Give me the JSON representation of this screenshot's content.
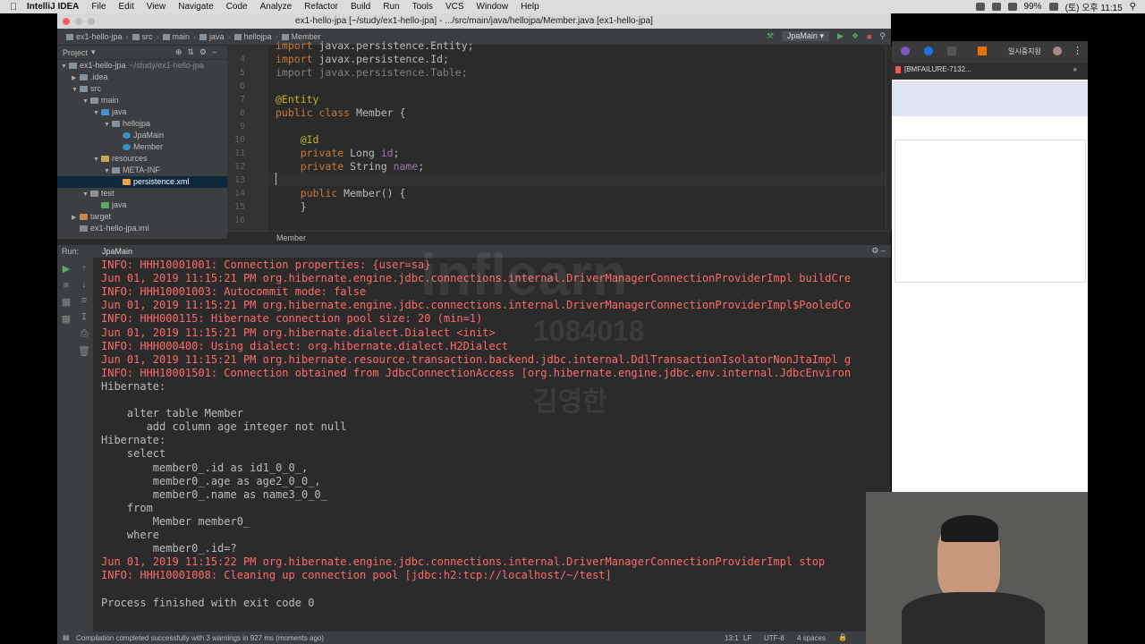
{
  "menubar": {
    "app_name": "IntelliJ IDEA",
    "items": [
      "File",
      "Edit",
      "View",
      "Navigate",
      "Code",
      "Analyze",
      "Refactor",
      "Build",
      "Run",
      "Tools",
      "VCS",
      "Window",
      "Help"
    ],
    "battery": "99%",
    "clock": "(토) 오후 11:15"
  },
  "window": {
    "title": "ex1-hello-jpa [~/study/ex1-hello-jpa] - .../src/main/java/hellojpa/Member.java [ex1-hello-jpa]"
  },
  "navbar": {
    "crumbs": [
      "ex1-hello-jpa",
      "src",
      "main",
      "java",
      "hellojpa",
      "Member"
    ],
    "run_config": "JpaMain"
  },
  "project": {
    "header": "Project",
    "tree": [
      {
        "label": "ex1-hello-jpa",
        "extra": "~/study/ex1-hello-jpa",
        "depth": 0,
        "arrow": "▼",
        "kind": "module"
      },
      {
        "label": ".idea",
        "depth": 1,
        "arrow": "▶",
        "kind": "folder"
      },
      {
        "label": "src",
        "depth": 1,
        "arrow": "▼",
        "kind": "folder"
      },
      {
        "label": "main",
        "depth": 2,
        "arrow": "▼",
        "kind": "folder"
      },
      {
        "label": "java",
        "depth": 3,
        "arrow": "▼",
        "kind": "src"
      },
      {
        "label": "hellojpa",
        "depth": 4,
        "arrow": "▼",
        "kind": "package"
      },
      {
        "label": "JpaMain",
        "depth": 5,
        "arrow": "",
        "kind": "class"
      },
      {
        "label": "Member",
        "depth": 5,
        "arrow": "",
        "kind": "class"
      },
      {
        "label": "resources",
        "depth": 3,
        "arrow": "▼",
        "kind": "res"
      },
      {
        "label": "META-INF",
        "depth": 4,
        "arrow": "▼",
        "kind": "folder"
      },
      {
        "label": "persistence.xml",
        "depth": 5,
        "arrow": "",
        "kind": "xml",
        "selected": true
      },
      {
        "label": "test",
        "depth": 2,
        "arrow": "▼",
        "kind": "folder"
      },
      {
        "label": "java",
        "depth": 3,
        "arrow": "",
        "kind": "test"
      },
      {
        "label": "target",
        "depth": 1,
        "arrow": "▶",
        "kind": "target"
      },
      {
        "label": "ex1-hello-jpa.iml",
        "depth": 1,
        "arrow": "",
        "kind": "file"
      }
    ]
  },
  "editor": {
    "lines": [
      {
        "n": "",
        "html": "<span class='kw'>import</span> javax.persistence.Entity;"
      },
      {
        "n": "4",
        "html": "<span class='kw'>import</span> javax.persistence.Id;"
      },
      {
        "n": "5",
        "html": "<span class='dim'>import javax.persistence.Table;</span>"
      },
      {
        "n": "6",
        "html": ""
      },
      {
        "n": "7",
        "html": "<span class='an'>@Entity</span>"
      },
      {
        "n": "8",
        "html": "<span class='kw'>public class</span> Member {"
      },
      {
        "n": "9",
        "html": ""
      },
      {
        "n": "10",
        "html": "    <span class='an'>@Id</span>"
      },
      {
        "n": "11",
        "html": "    <span class='kw'>private</span> Long <span class='fld'>id</span>;"
      },
      {
        "n": "12",
        "html": "    <span class='kw'>private</span> String <span class='fld'>name</span>;"
      },
      {
        "n": "13",
        "html": ""
      },
      {
        "n": "14",
        "html": "    <span class='kw'>public</span> Member() {"
      },
      {
        "n": "15",
        "html": "    }"
      },
      {
        "n": "16",
        "html": ""
      }
    ],
    "breadcrumb": "Member"
  },
  "run": {
    "label": "Run:",
    "tab": "JpaMain",
    "console": [
      {
        "t": "INFO: HHH10001001: Connection properties: {user=sa}",
        "red": true
      },
      {
        "t": "Jun 01, 2019 11:15:21 PM org.hibernate.engine.jdbc.connections.internal.DriverManagerConnectionProviderImpl buildCre",
        "red": true
      },
      {
        "t": "INFO: HHH10001003: Autocommit mode: false",
        "red": true
      },
      {
        "t": "Jun 01, 2019 11:15:21 PM org.hibernate.engine.jdbc.connections.internal.DriverManagerConnectionProviderImpl$PooledCo",
        "red": true
      },
      {
        "t": "INFO: HHH000115: Hibernate connection pool size: 20 (min=1)",
        "red": true
      },
      {
        "t": "Jun 01, 2019 11:15:21 PM org.hibernate.dialect.Dialect <init>",
        "red": true
      },
      {
        "t": "INFO: HHH000400: Using dialect: org.hibernate.dialect.H2Dialect",
        "red": true
      },
      {
        "t": "Jun 01, 2019 11:15:21 PM org.hibernate.resource.transaction.backend.jdbc.internal.DdlTransactionIsolatorNonJtaImpl g",
        "red": true
      },
      {
        "t": "INFO: HHH10001501: Connection obtained from JdbcConnectionAccess [org.hibernate.engine.jdbc.env.internal.JdbcEnviron",
        "red": true
      },
      {
        "t": "Hibernate: ",
        "red": false
      },
      {
        "t": "",
        "red": false
      },
      {
        "t": "    alter table Member ",
        "red": false
      },
      {
        "t": "       add column age integer not null",
        "red": false
      },
      {
        "t": "Hibernate: ",
        "red": false
      },
      {
        "t": "    select",
        "red": false
      },
      {
        "t": "        member0_.id as id1_0_0_,",
        "red": false
      },
      {
        "t": "        member0_.age as age2_0_0_,",
        "red": false
      },
      {
        "t": "        member0_.name as name3_0_0_ ",
        "red": false
      },
      {
        "t": "    from",
        "red": false
      },
      {
        "t": "        Member member0_ ",
        "red": false
      },
      {
        "t": "    where",
        "red": false
      },
      {
        "t": "        member0_.id=?",
        "red": false
      },
      {
        "t": "Jun 01, 2019 11:15:22 PM org.hibernate.engine.jdbc.connections.internal.DriverManagerConnectionProviderImpl stop",
        "red": true
      },
      {
        "t": "INFO: HHH10001008: Cleaning up connection pool [jdbc:h2:tcp://localhost/~/test]",
        "red": true
      },
      {
        "t": "",
        "red": false
      },
      {
        "t": "Process finished with exit code 0",
        "red": false
      }
    ]
  },
  "status": {
    "message": "Compilation completed successfully with 3 warnings in 927 ms (moments ago)",
    "position": "13:1",
    "line_sep": "LF",
    "encoding": "UTF-8",
    "indent": "4 spaces"
  },
  "browser": {
    "tab_text": "[BMFAILURE-7132...",
    "korean_label": "일시중지됨"
  },
  "watermark": {
    "brand": "inflearn",
    "id": "1084018",
    "name": "김영한"
  }
}
